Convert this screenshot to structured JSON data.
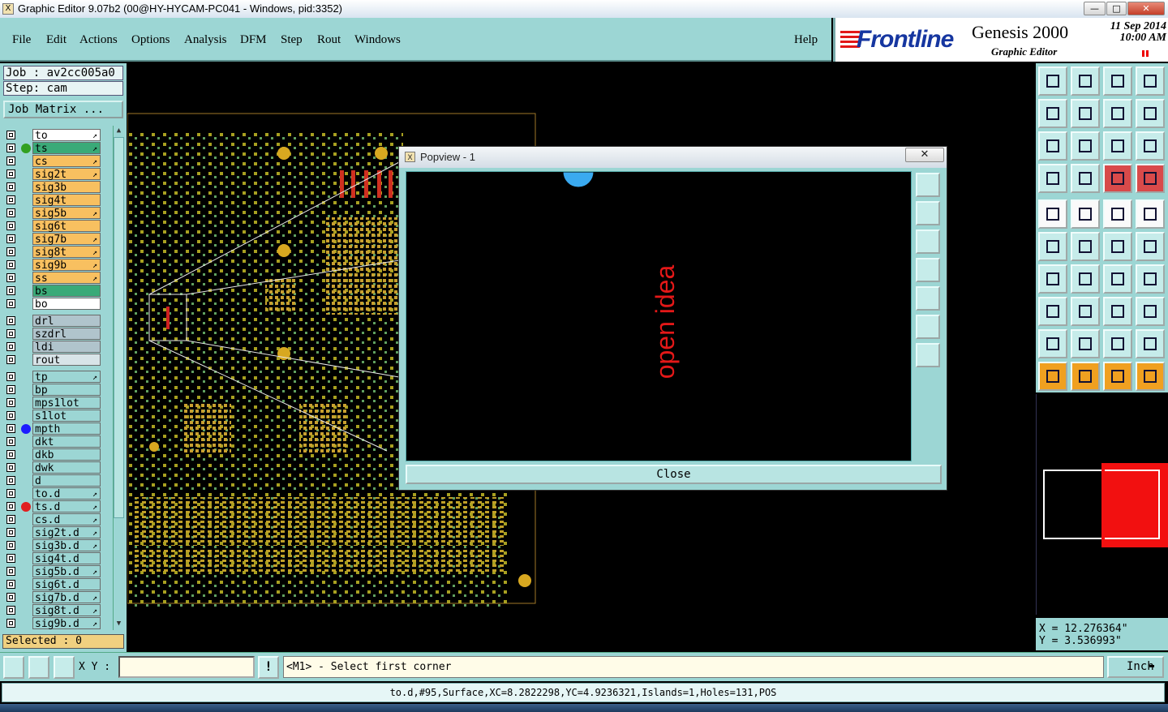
{
  "window": {
    "title": "Graphic Editor 9.07b2 (00@HY-HYCAM-PC041 - Windows, pid:3352)",
    "minimize": "—",
    "restore": "□",
    "close": "✕"
  },
  "menu": {
    "items": [
      "File",
      "Edit",
      "Actions",
      "Options",
      "Analysis",
      "DFM",
      "Step",
      "Rout",
      "Windows"
    ],
    "help": "Help"
  },
  "logo": {
    "brand": "Frontline",
    "product": "Genesis 2000",
    "subtitle": "Graphic Editor",
    "date": "11  Sep  2014",
    "time": "10:00  AM"
  },
  "job": {
    "job_line": "Job : av2cc005a0",
    "step_line": "Step: cam",
    "matrix_button": "Job Matrix ..."
  },
  "layers": [
    {
      "name": "to",
      "bg": "#ffffff",
      "arrow": true
    },
    {
      "name": "ts",
      "bg": "#3aaa78",
      "arrow": true,
      "dot": "#32a020"
    },
    {
      "name": "cs",
      "bg": "#f8c060",
      "arrow": true
    },
    {
      "name": "sig2t",
      "bg": "#f8c060",
      "arrow": true
    },
    {
      "name": "sig3b",
      "bg": "#f8c060",
      "arrow": false
    },
    {
      "name": "sig4t",
      "bg": "#f8c060",
      "arrow": false
    },
    {
      "name": "sig5b",
      "bg": "#f8c060",
      "arrow": true
    },
    {
      "name": "sig6t",
      "bg": "#f8c060",
      "arrow": false
    },
    {
      "name": "sig7b",
      "bg": "#f8c060",
      "arrow": true
    },
    {
      "name": "sig8t",
      "bg": "#f8c060",
      "arrow": true
    },
    {
      "name": "sig9b",
      "bg": "#f8c060",
      "arrow": true
    },
    {
      "name": "ss",
      "bg": "#f8c060",
      "arrow": true
    },
    {
      "name": "bs",
      "bg": "#3aaa78",
      "arrow": false
    },
    {
      "name": "bo",
      "bg": "#ffffff",
      "arrow": false
    },
    {
      "name": "drl",
      "bg": "#b0c4cc",
      "arrow": false,
      "gap": true
    },
    {
      "name": "szdrl",
      "bg": "#b0c4cc",
      "arrow": false
    },
    {
      "name": "ldi",
      "bg": "#b0c4cc",
      "arrow": false
    },
    {
      "name": "rout",
      "bg": "#d8e4e8",
      "arrow": false
    },
    {
      "name": "tp",
      "bg": "#9cd6d4",
      "arrow": true,
      "gap": true
    },
    {
      "name": "bp",
      "bg": "#9cd6d4",
      "arrow": false
    },
    {
      "name": "mps1lot",
      "bg": "#9cd6d4",
      "arrow": false
    },
    {
      "name": "s1lot",
      "bg": "#9cd6d4",
      "arrow": false
    },
    {
      "name": "mpth",
      "bg": "#9cd6d4",
      "arrow": false,
      "dot": "#1c1cff"
    },
    {
      "name": "dkt",
      "bg": "#9cd6d4",
      "arrow": false
    },
    {
      "name": "dkb",
      "bg": "#9cd6d4",
      "arrow": false
    },
    {
      "name": "dwk",
      "bg": "#9cd6d4",
      "arrow": false
    },
    {
      "name": "d",
      "bg": "#9cd6d4",
      "arrow": false
    },
    {
      "name": "to.d",
      "bg": "#9cd6d4",
      "arrow": true
    },
    {
      "name": "ts.d",
      "bg": "#9cd6d4",
      "arrow": true,
      "dot": "#e02020"
    },
    {
      "name": "cs.d",
      "bg": "#9cd6d4",
      "arrow": true
    },
    {
      "name": "sig2t.d",
      "bg": "#9cd6d4",
      "arrow": true
    },
    {
      "name": "sig3b.d",
      "bg": "#9cd6d4",
      "arrow": true
    },
    {
      "name": "sig4t.d",
      "bg": "#9cd6d4",
      "arrow": false
    },
    {
      "name": "sig5b.d",
      "bg": "#9cd6d4",
      "arrow": true
    },
    {
      "name": "sig6t.d",
      "bg": "#9cd6d4",
      "arrow": false
    },
    {
      "name": "sig7b.d",
      "bg": "#9cd6d4",
      "arrow": true
    },
    {
      "name": "sig8t.d",
      "bg": "#9cd6d4",
      "arrow": true
    },
    {
      "name": "sig9b.d",
      "bg": "#9cd6d4",
      "arrow": true
    }
  ],
  "selected": "Selected : 0",
  "popview": {
    "title": "Popview - 1",
    "close_x": "✕",
    "canvas_text": "open idea",
    "close_button": "Close"
  },
  "coords": {
    "x": "X = 12.276364\"",
    "y": "Y = 3.536993\""
  },
  "bottom": {
    "xy_label": "X Y :",
    "xy_value": "",
    "prompt": "<M1> - Select first corner",
    "units": "Inch"
  },
  "status": "to.d,#95,Surface,XC=8.2822298,YC=4.9236321,Islands=1,Holes=131,POS",
  "colors": {
    "panel": "#9cd6d4",
    "orange": "#f8c060",
    "green": "#3aaa78",
    "accent_red": "#e02020"
  }
}
